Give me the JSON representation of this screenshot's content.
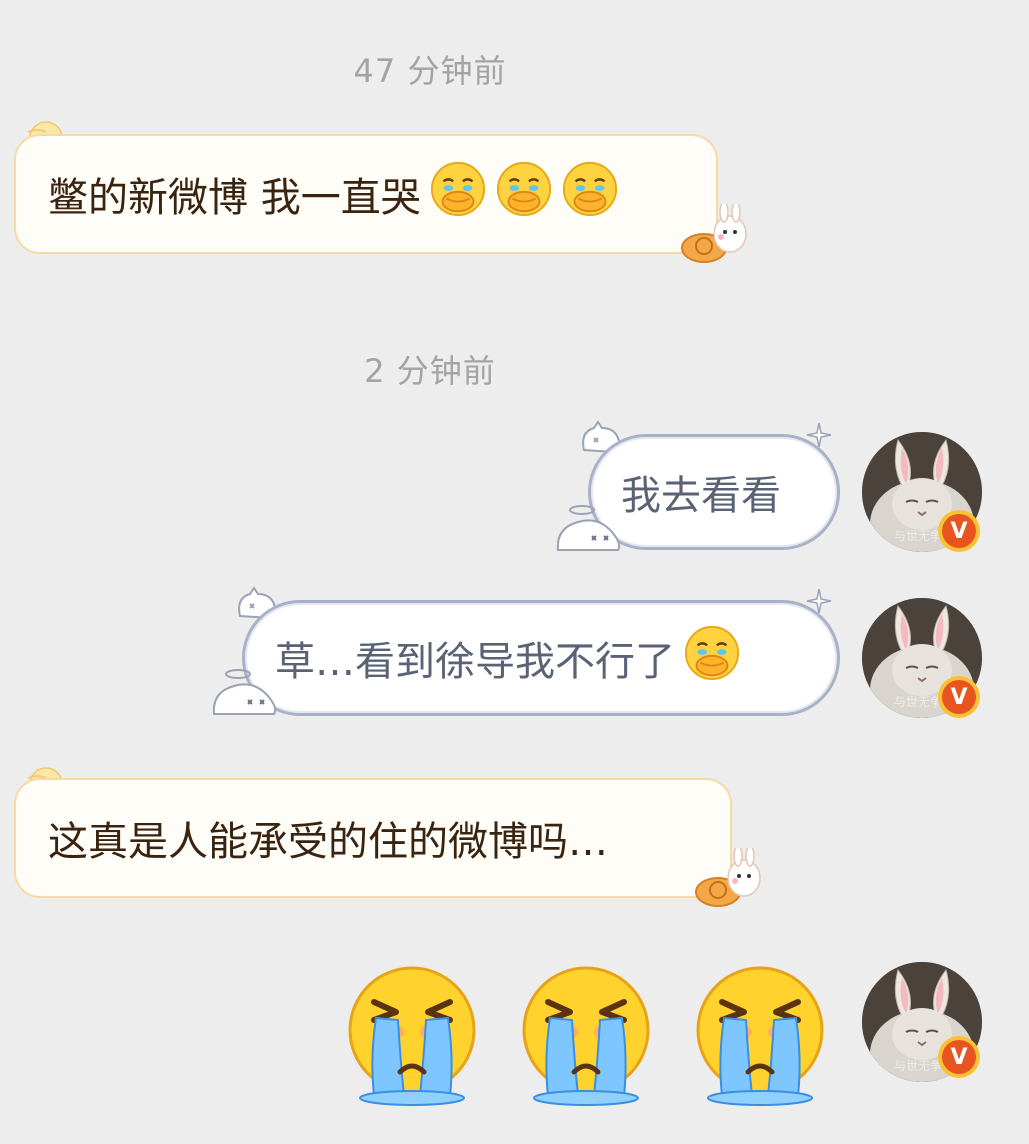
{
  "chat": {
    "timestamps": [
      "47 分钟前",
      "2 分钟前"
    ],
    "messages": [
      {
        "side": "in",
        "text": "鳖的新微博 我一直哭",
        "emoji": "cry-cover-mouth-emoji",
        "emoji_count": 3
      },
      {
        "side": "out",
        "text": "我去看看"
      },
      {
        "side": "out",
        "text": "草…看到徐导我不行了",
        "emoji": "cry-cover-mouth-emoji",
        "emoji_count": 1
      },
      {
        "side": "in",
        "text": "这真是人能承受的住的微博吗…"
      },
      {
        "side": "out",
        "emoji": "loud-crying-emoji",
        "emoji_count": 3
      }
    ]
  },
  "avatar": {
    "watermark": "与世无争",
    "verified_badge": "V"
  },
  "colors": {
    "background": "#ededed",
    "in_bubble_border": "#f7d9a4",
    "out_bubble_border": "#a9b1c7",
    "timestamp_text": "#a3a3a3",
    "badge": "#e8541f"
  }
}
